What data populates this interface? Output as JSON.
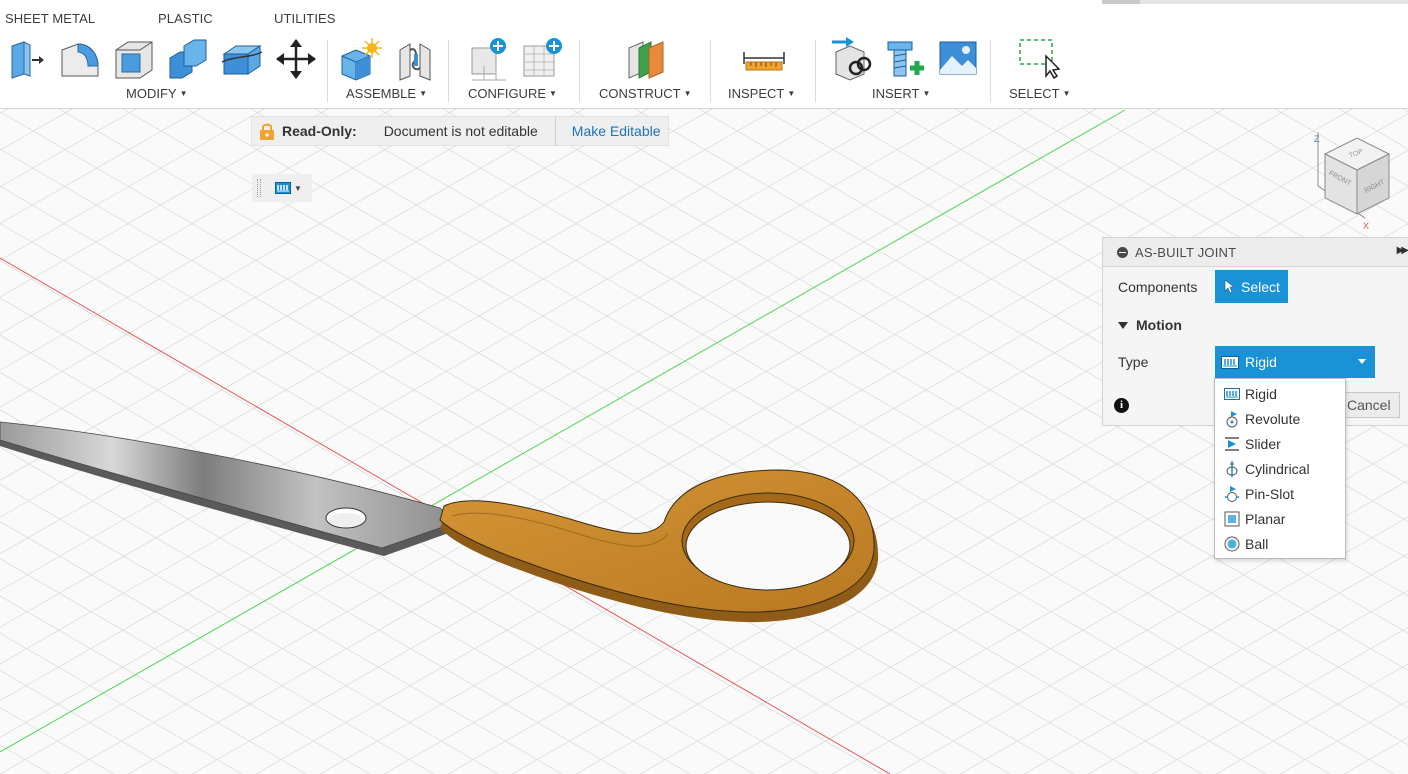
{
  "tabs": [
    "SHEET METAL",
    "PLASTIC",
    "UTILITIES"
  ],
  "groups": {
    "modify": "MODIFY",
    "assemble": "ASSEMBLE",
    "configure": "CONFIGURE",
    "construct": "CONSTRUCT",
    "inspect": "INSPECT",
    "insert": "INSERT",
    "select": "SELECT"
  },
  "banner": {
    "label": "Read-Only:",
    "message": "Document is not editable",
    "action": "Make Editable"
  },
  "viewcube": {
    "z": "Z",
    "x": "X",
    "top": "TOP",
    "front": "FRONT",
    "right": "RIGHT"
  },
  "panel": {
    "title": "AS-BUILT JOINT",
    "components_label": "Components",
    "select_label": "Select",
    "motion_label": "Motion",
    "type_label": "Type",
    "type_value": "Rigid",
    "cancel_label": "Cancel",
    "info_glyph": "i"
  },
  "type_options": [
    "Rigid",
    "Revolute",
    "Slider",
    "Cylindrical",
    "Pin-Slot",
    "Planar",
    "Ball"
  ],
  "colors": {
    "accent": "#1a92d6",
    "handle": "#c98a2e",
    "blade": "#8a8a8a",
    "grid": "#d9d9d9",
    "axis_x": "#e35a5a",
    "axis_y": "#4cd64c",
    "lock": "#f0a42e"
  }
}
